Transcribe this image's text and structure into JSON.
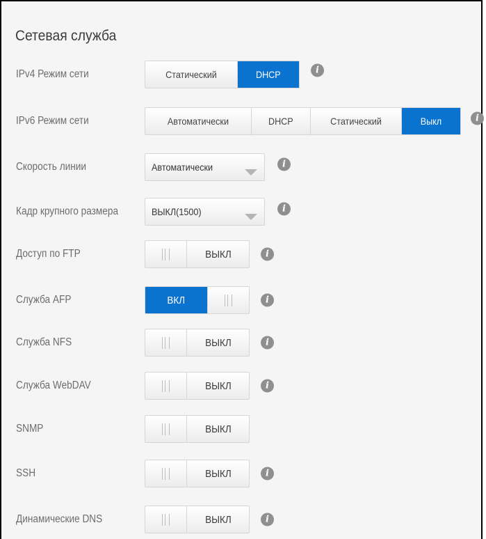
{
  "title": "Сетевая служба",
  "colors": {
    "accent": "#0a72cf",
    "panel": "#f5f5f5",
    "label": "#6d6d6d"
  },
  "rows": {
    "ipv4": {
      "label": "IPv4 Режим сети",
      "options": [
        "Статический",
        "DHCP"
      ],
      "selected": "DHCP"
    },
    "ipv6": {
      "label": "IPv6 Режим сети",
      "options": [
        "Автоматически",
        "DHCP",
        "Статический",
        "Выкл"
      ],
      "selected": "Выкл"
    },
    "link_speed": {
      "label": "Скорость линии",
      "value": "Автоматически"
    },
    "jumbo_frame": {
      "label": "Кадр крупного размера",
      "value": "ВЫКЛ(1500)"
    },
    "ftp": {
      "label": "Доступ по FTP",
      "state": "ВЫКЛ",
      "on": false
    },
    "afp": {
      "label": "Служба AFP",
      "state": "ВКЛ",
      "on": true
    },
    "nfs": {
      "label": "Служба NFS",
      "state": "ВЫКЛ",
      "on": false
    },
    "webdav": {
      "label": "Служба WebDAV",
      "state": "ВЫКЛ",
      "on": false
    },
    "snmp": {
      "label": "SNMP",
      "state": "ВЫКЛ",
      "on": false
    },
    "ssh": {
      "label": "SSH",
      "state": "ВЫКЛ",
      "on": false
    },
    "ddns": {
      "label": "Динамические DNS",
      "state": "ВЫКЛ",
      "on": false
    }
  },
  "info_icon": {
    "glyph": "i",
    "icon": "info-icon"
  }
}
